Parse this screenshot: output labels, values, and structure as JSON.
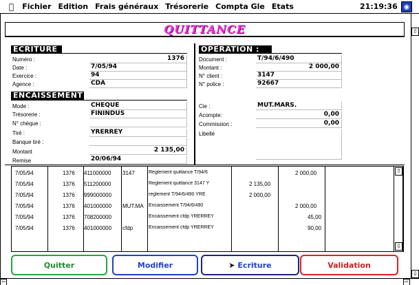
{
  "menubar": {
    "apple": "",
    "items": [
      "Fichier",
      "Edition",
      "Frais généraux",
      "Trésorerie",
      "Compta Gle",
      "Etats"
    ],
    "clock": "21:19:36"
  },
  "title": "QUITTANCE",
  "ecriture": {
    "header": "ECRITURE :",
    "fields": [
      {
        "label": "Numéro :",
        "value": "1376"
      },
      {
        "label": "Date :",
        "value": "7/05/94"
      },
      {
        "label": "Exercice :",
        "value": "94"
      },
      {
        "label": "Agence :",
        "value": "CDA"
      }
    ]
  },
  "encaissement": {
    "header": "ENCAISSEMENT :",
    "fields": [
      {
        "label": "Mode :",
        "value": "CHEQUE"
      },
      {
        "label": "Trésorerie :",
        "value": "FININDUS"
      },
      {
        "label": "N° chèque :",
        "value": ""
      },
      {
        "label": "Tiré :",
        "value": "YRERREY"
      },
      {
        "label": "Banque tiré :",
        "value": ""
      },
      {
        "label": "Montant",
        "value": "2 135,00"
      },
      {
        "label": "Remise",
        "value": "20/06/94"
      }
    ]
  },
  "operation": {
    "header": "OPERATION :",
    "fields": [
      {
        "label": "Document :",
        "value": "T/94/6/490"
      },
      {
        "label": "Montant :",
        "value": "2 000,00"
      },
      {
        "label": "N° client :",
        "value": "3147"
      },
      {
        "label": "N° police :",
        "value": "92667"
      }
    ],
    "fields2": [
      {
        "label": "Cie :",
        "value": "MUT.MARS."
      },
      {
        "label": "Acompte:",
        "value": "0,00"
      },
      {
        "label": "Commission :",
        "value": "0,00"
      },
      {
        "label": "Libellé",
        "value": ""
      }
    ]
  },
  "entries": [
    {
      "date": "7/05/94",
      "num": "1376",
      "compte": "411000000",
      "ref": "3147",
      "libelle": "Reglement quittance T/94/6",
      "debit": "",
      "credit": "2 000,00"
    },
    {
      "date": "7/05/94",
      "num": "1376",
      "compte": "511200000",
      "ref": "",
      "libelle": "Reglement quittance 3147 Y",
      "debit": "2 135,00",
      "credit": ""
    },
    {
      "date": "7/05/94",
      "num": "1376",
      "compte": "999000000",
      "ref": "",
      "libelle": "reglement T/94/6/490 YRE",
      "debit": "2 000,00",
      "credit": ""
    },
    {
      "date": "7/05/94",
      "num": "1376",
      "compte": "401000000",
      "ref": "MUT.MA",
      "libelle": "Encaissement T/94/6/490",
      "debit": "",
      "credit": "2 000,00"
    },
    {
      "date": "7/05/94",
      "num": "1376",
      "compte": "708200000",
      "ref": "",
      "libelle": "Encaissement cfdp YRERREY",
      "debit": "",
      "credit": "45,00"
    },
    {
      "date": "7/05/94",
      "num": "1376",
      "compte": "401000000",
      "ref": "cfdp",
      "libelle": "Encaissement cfdp YRERREY",
      "debit": "",
      "credit": "90,00"
    }
  ],
  "buttons": {
    "quitter": "Quitter",
    "modifier": "Modifier",
    "ecriture": "Ecriture",
    "validation": "Validation"
  },
  "colors": {
    "title": "#f02ad6",
    "quitter": "#21a63b",
    "modifier": "#2140c8",
    "validation": "#e02020"
  }
}
